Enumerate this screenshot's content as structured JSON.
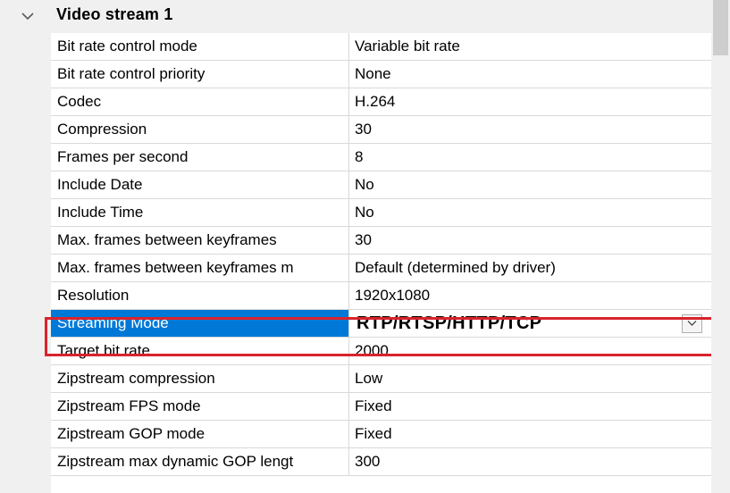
{
  "category": {
    "label": "Video stream 1",
    "icon": "chevron-down-icon"
  },
  "properties": [
    {
      "name": "Bit rate control mode",
      "value": "Variable bit rate"
    },
    {
      "name": "Bit rate control priority",
      "value": "None"
    },
    {
      "name": "Codec",
      "value": "H.264"
    },
    {
      "name": "Compression",
      "value": "30"
    },
    {
      "name": "Frames per second",
      "value": "8"
    },
    {
      "name": "Include Date",
      "value": "No"
    },
    {
      "name": "Include Time",
      "value": "No"
    },
    {
      "name": "Max. frames between keyframes",
      "value": "30"
    },
    {
      "name": "Max. frames between keyframes m",
      "value": "Default (determined by driver)"
    },
    {
      "name": "Resolution",
      "value": "1920x1080"
    },
    {
      "name": "Streaming Mode",
      "value": "RTP/RTSP/HTTP/TCP",
      "selected": true
    },
    {
      "name": "Target bit rate",
      "value": "2000"
    },
    {
      "name": "Zipstream compression",
      "value": "Low"
    },
    {
      "name": "Zipstream FPS mode",
      "value": "Fixed"
    },
    {
      "name": "Zipstream GOP mode",
      "value": "Fixed"
    },
    {
      "name": "Zipstream max dynamic GOP lengt",
      "value": "300"
    }
  ],
  "colors": {
    "selection": "#0078d7",
    "highlight_border": "#d9232d",
    "gutter": "#f0f0f0",
    "gridline": "#d9d9d9"
  }
}
